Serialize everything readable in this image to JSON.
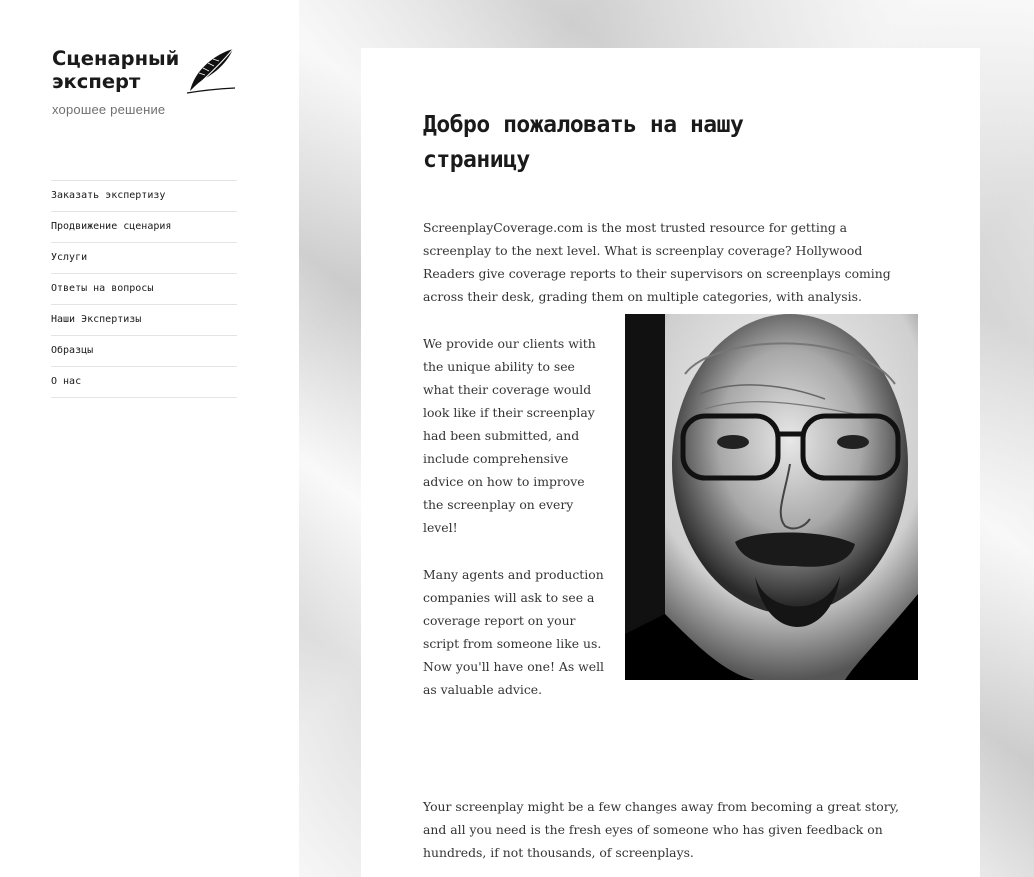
{
  "site": {
    "title": "Сценарный эксперт",
    "tagline": "хорошее решение"
  },
  "nav": {
    "items": [
      {
        "label": "Заказать экспертизу"
      },
      {
        "label": "Продвижение сценария"
      },
      {
        "label": "Услуги"
      },
      {
        "label": "Ответы на вопросы"
      },
      {
        "label": "Наши Экспертизы"
      },
      {
        "label": "Образцы"
      },
      {
        "label": "О нас"
      }
    ]
  },
  "article": {
    "title": "Добро пожаловать на нашу страницу",
    "p1": "ScreenplayCoverage.com is the most trusted resource for getting a screenplay to the next level. What is screenplay coverage? Hollywood Readers give coverage reports to their supervisors on screenplays coming across their desk, grading them on multiple categories, with analysis.",
    "p2": "We provide our clients with the unique ability to see what their coverage would look like if their screenplay had been submitted, and include comprehensive advice on how to improve the screenplay on every level!",
    "p3": "Many agents and production companies will ask to see a coverage report on your script from someone like us. Now you'll have one! As well as valuable advice.",
    "p4": "Your screenplay might be a few changes away from becoming a great story, and all you need is the fresh eyes of someone who has given feedback on hundreds, if not thousands, of screenplays."
  },
  "icons": {
    "brand": "feather-quill-icon",
    "article_image": "portrait-image"
  },
  "colors": {
    "text": "#1a1a1a",
    "body_text": "#333333",
    "tagline": "#707070",
    "divider": "#e4e4e4"
  }
}
